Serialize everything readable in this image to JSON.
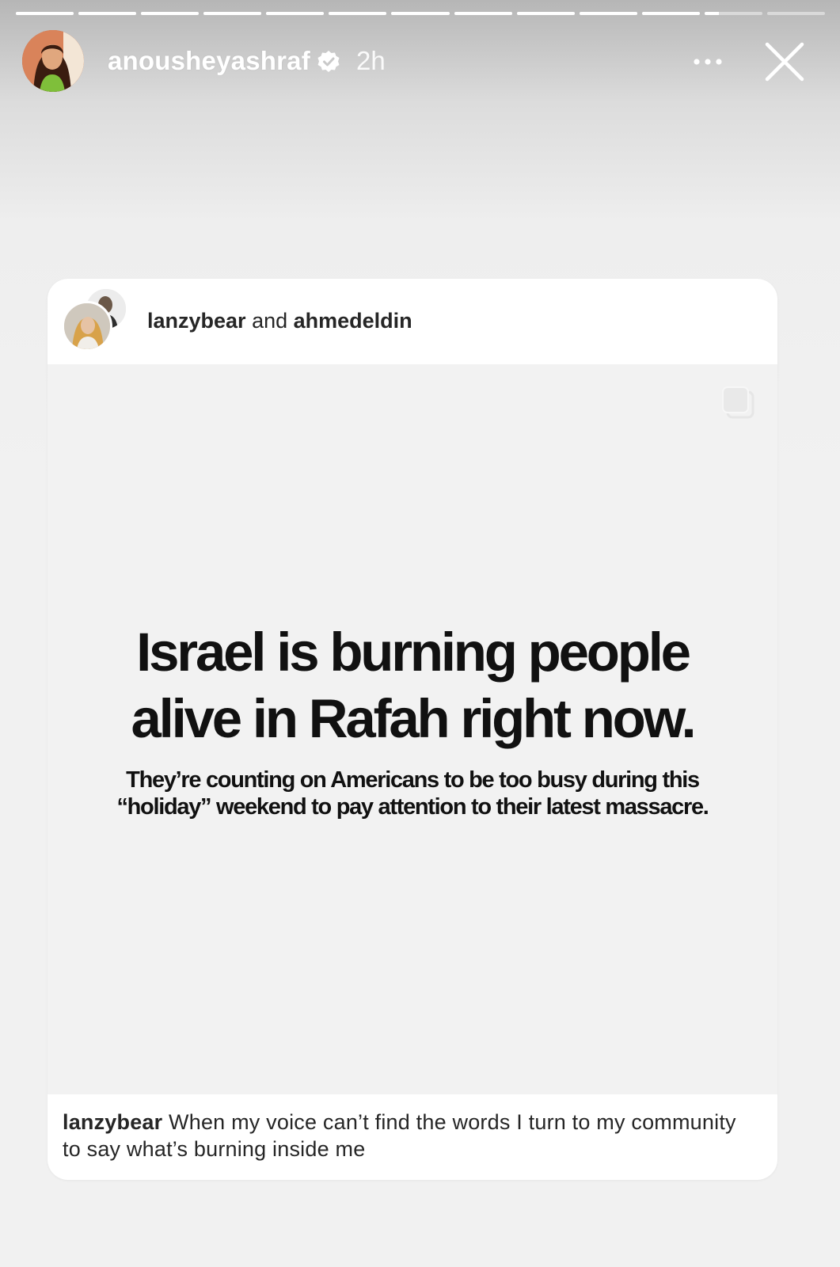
{
  "story": {
    "progress_segments": [
      1,
      1,
      1,
      1,
      1,
      1,
      1,
      1,
      1,
      1,
      1,
      0.25,
      0
    ],
    "author": {
      "username": "anousheyashraf",
      "verified": true,
      "time_ago": "2h"
    },
    "more_icon": "more-horizontal-icon",
    "close_icon": "close-icon"
  },
  "shared_post": {
    "collab_first": "lanzybear",
    "collab_joiner": " and ",
    "collab_second": "ahmedeldin",
    "carousel_icon": "carousel-icon",
    "image": {
      "headline_line1": "Israel is burning people",
      "headline_line2": "alive in Rafah right now.",
      "subhead_line1": "They’re counting on Americans to be too busy during this",
      "subhead_line2": "“holiday” weekend to pay attention to their latest massacre."
    },
    "caption": {
      "username": "lanzybear",
      "text": " When my voice can’t find the words I turn to my community to say what’s burning inside me"
    }
  },
  "colors": {
    "background": "#f1f1f1",
    "card": "#ffffff",
    "headline_text": "#111111",
    "caption_text": "#262626"
  }
}
